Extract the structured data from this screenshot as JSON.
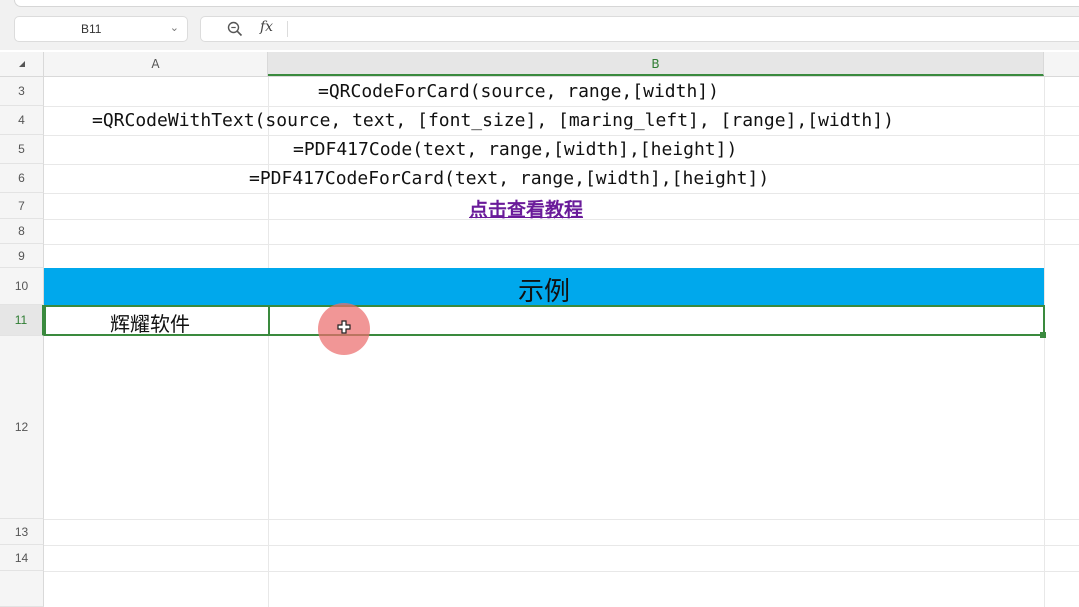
{
  "formula_bar": {
    "name_box_value": "B11",
    "name_box_chevron": "⌄",
    "zoom_icon": "zoom-icon",
    "fx_label": "fx",
    "formula_value": ""
  },
  "columns": [
    "A",
    "B"
  ],
  "rows": [
    "3",
    "4",
    "5",
    "6",
    "7",
    "8",
    "9",
    "10",
    "11",
    "12",
    "13",
    "14"
  ],
  "active_cell": "B11",
  "cells": {
    "row3": "=QRCodeForCard(source, range,[width])",
    "row4": "=QRCodeWithText(source, text, [font_size], [maring_left], [range],[width])",
    "row5": "=PDF417Code(text, range,[width],[height])",
    "row6": "=PDF417CodeForCard(text, range,[width],[height])",
    "row7_link": "点击查看教程",
    "row10_title": "示例",
    "a11": "辉耀软件",
    "b11": ""
  },
  "colors": {
    "header_band": "#00a8ec",
    "selection": "#3a8a3e",
    "link": "#6a1b9a",
    "cursor_highlight": "#eb6e6e"
  }
}
